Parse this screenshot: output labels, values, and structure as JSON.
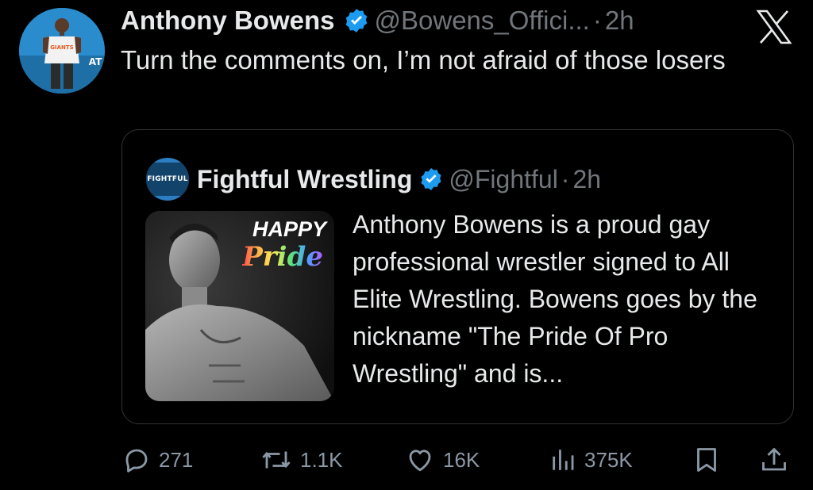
{
  "author": {
    "name": "Anthony Bowens",
    "handle": "@Bowens_Offici...",
    "separator": "·",
    "time": "2h",
    "verified_color": "#1d9bf0"
  },
  "tweet": {
    "text": "Turn the comments on, I’m not afraid of those losers"
  },
  "quote": {
    "name": "Fightful Wrestling",
    "handle": "@Fightful",
    "separator": "·",
    "time": "2h",
    "avatar_text": "FIGHTFUL",
    "image_text_1": "HAPPY",
    "image_text_2": "Pride",
    "text": "Anthony Bowens is a proud gay professional wrestler signed to All Elite Wrestling. Bowens goes by the nickname \"The Pride Of Pro Wrestling\" and is..."
  },
  "actions": {
    "replies": "271",
    "reposts": "1.1K",
    "likes": "16K",
    "views": "375K"
  },
  "icons": {
    "reply": "reply-icon",
    "repost": "repost-icon",
    "like": "heart-icon",
    "views": "views-icon",
    "bookmark": "bookmark-icon",
    "share": "share-icon",
    "brand": "x-logo-icon"
  },
  "colors": {
    "background": "#000000",
    "text": "#e7e9ea",
    "muted": "#71767b",
    "accent": "#1d9bf0",
    "border": "#2f3336"
  }
}
